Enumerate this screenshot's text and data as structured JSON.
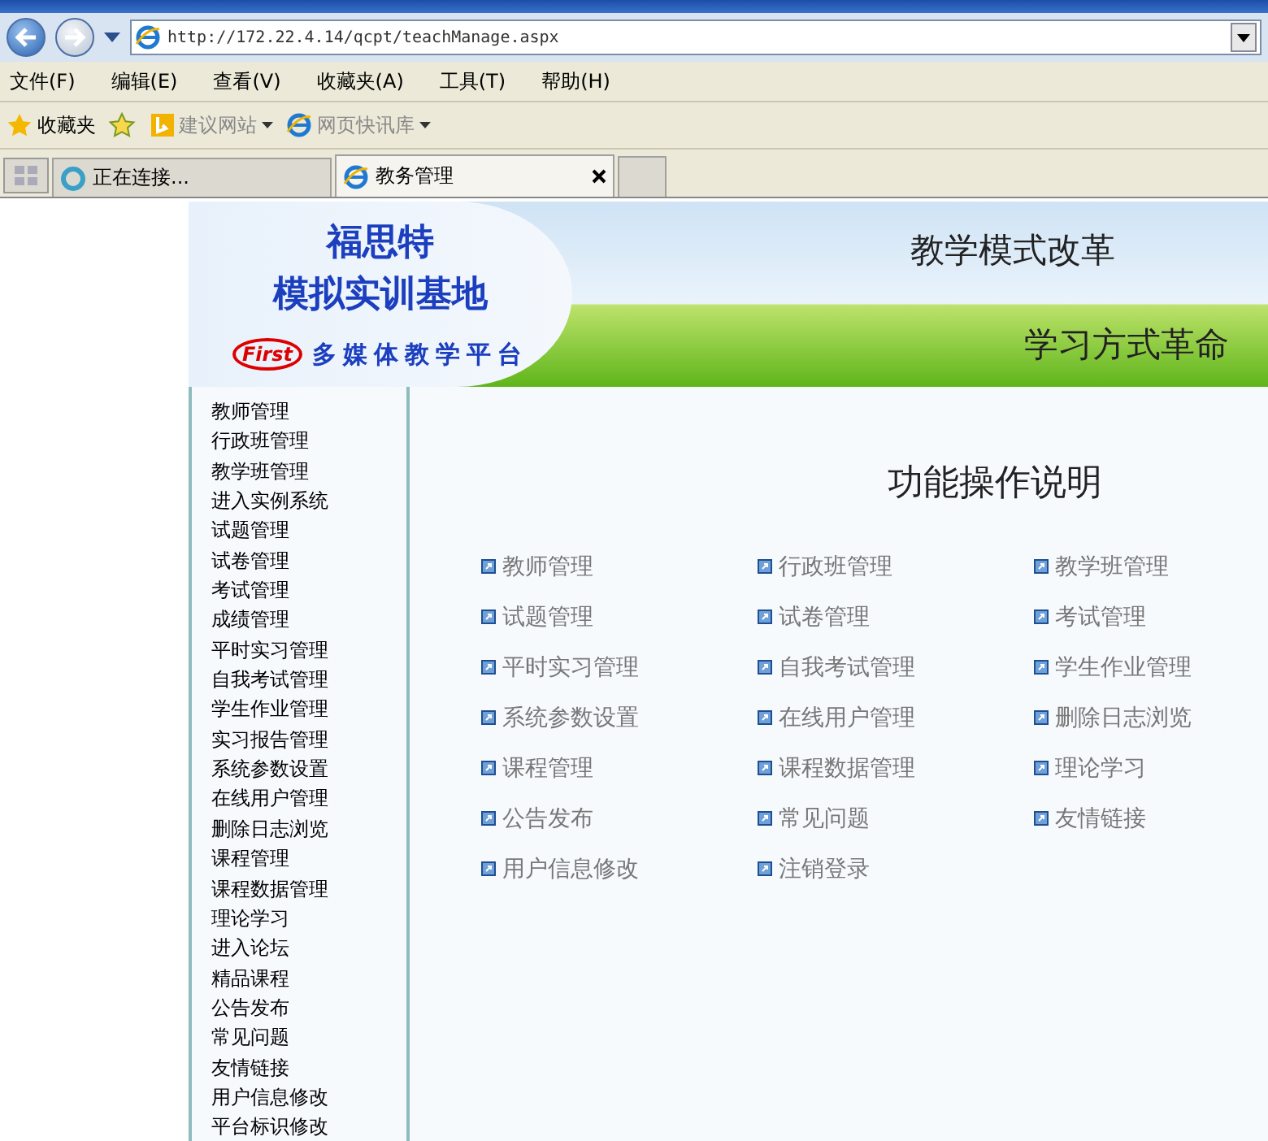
{
  "address_bar": {
    "url": "http://172.22.4.14/qcpt/teachManage.aspx"
  },
  "menu_bar": [
    "文件(F)",
    "编辑(E)",
    "查看(V)",
    "收藏夹(A)",
    "工具(T)",
    "帮助(H)"
  ],
  "favorites_bar": {
    "label": "收藏夹",
    "links": [
      {
        "label": "建议网站",
        "kind": "bing"
      },
      {
        "label": "网页快讯库",
        "kind": "ie"
      }
    ]
  },
  "tabs": [
    {
      "label": "正在连接...",
      "selected": false,
      "kind": "loading"
    },
    {
      "label": "教务管理",
      "selected": true,
      "kind": "page"
    }
  ],
  "banner": {
    "brand": "福思特",
    "base_name": "模拟实训基地",
    "logo_text": "First",
    "platform": "多媒体教学平台",
    "slogan_1": "教学模式改革",
    "slogan_2": "学习方式革命"
  },
  "sidebar": {
    "items": [
      "教师管理",
      "行政班管理",
      "教学班管理",
      "进入实例系统",
      "试题管理",
      "试卷管理",
      "考试管理",
      "成绩管理",
      "平时实习管理",
      "自我考试管理",
      "学生作业管理",
      "实习报告管理",
      "系统参数设置",
      "在线用户管理",
      "删除日志浏览",
      "课程管理",
      "课程数据管理",
      "理论学习",
      "进入论坛",
      "精品课程",
      "公告发布",
      "常见问题",
      "友情链接",
      "用户信息修改",
      "平台标识修改"
    ]
  },
  "main": {
    "title": "功能操作说明",
    "links": [
      "教师管理",
      "行政班管理",
      "教学班管理",
      "试题管理",
      "试卷管理",
      "考试管理",
      "平时实习管理",
      "自我考试管理",
      "学生作业管理",
      "系统参数设置",
      "在线用户管理",
      "删除日志浏览",
      "课程管理",
      "课程数据管理",
      "理论学习",
      "公告发布",
      "常见问题",
      "友情链接",
      "用户信息修改",
      "注销登录"
    ]
  }
}
